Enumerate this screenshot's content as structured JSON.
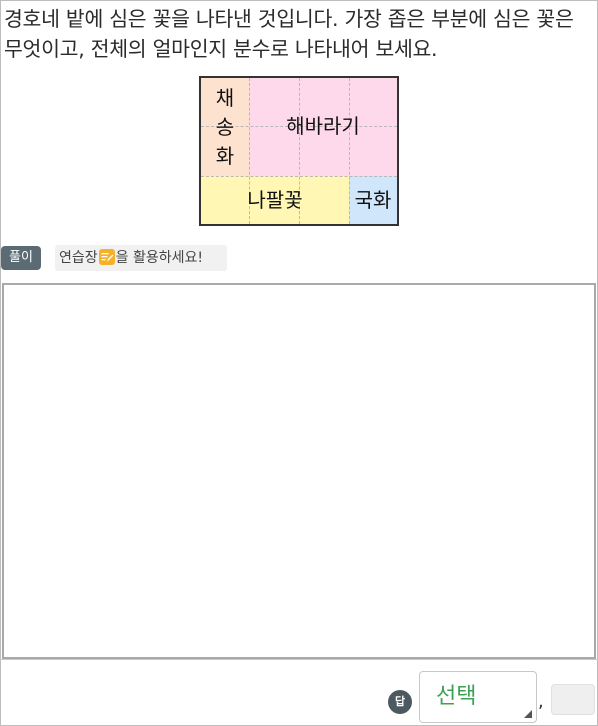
{
  "question": {
    "text": "경호네 밭에 심은 꽃을 나타낸 것입니다. 가장 좁은 부분에 심은 꽃은 무엇이고, 전체의 얼마인지 분수로 나타내어 보세요."
  },
  "garden": {
    "labels": {
      "top_left": [
        "채",
        "송",
        "화"
      ],
      "top_right": "해바라기",
      "bottom_left": "나팔꽃",
      "bottom_right": "국화"
    },
    "colors": {
      "top_left": "#fde3cf",
      "top_right": "#fed9ec",
      "bottom_left": "#fff7b3",
      "bottom_right": "#cfe6fb"
    }
  },
  "solve": {
    "badge_label": "풀이",
    "hint_before": "연습장",
    "hint_after": "을 활용하세요!",
    "hint_icon": "pencil-pad-icon"
  },
  "answer": {
    "badge_label": "답",
    "select_placeholder": "선택",
    "separator": ","
  }
}
